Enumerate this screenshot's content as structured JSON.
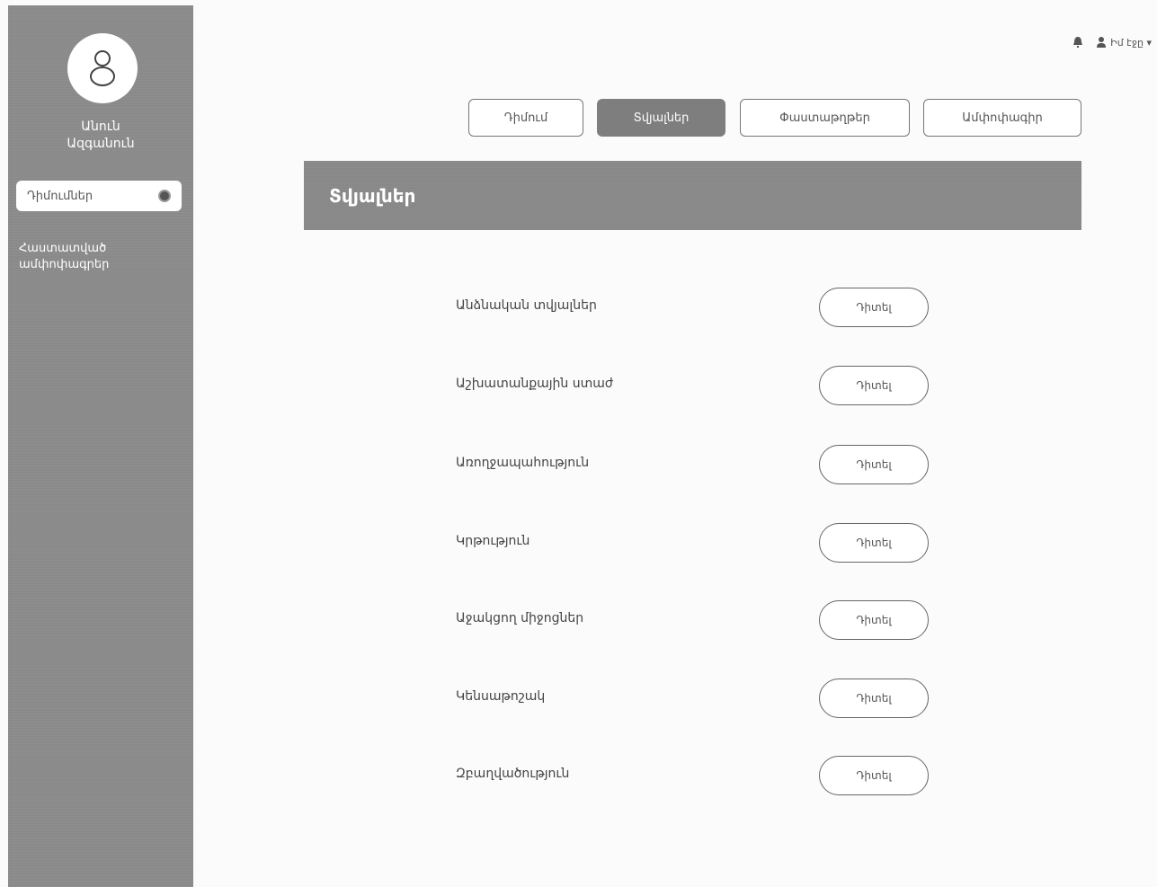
{
  "sidebar": {
    "user_first_name": "Անուն",
    "user_last_name": "Ազգանուն",
    "active_item_label": "Դիմումներ",
    "items": [
      {
        "label": "Հաստատված ամփոփագրեր"
      }
    ]
  },
  "topbar": {
    "user_label": "Իմ էջը ▾"
  },
  "tabs": [
    {
      "label": "Դիմում",
      "active": false
    },
    {
      "label": "Տվյալներ",
      "active": true
    },
    {
      "label": "Փաստաթղթեր",
      "active": false
    },
    {
      "label": "Ամփոփագիր",
      "active": false
    }
  ],
  "section": {
    "title": "Տվյալներ"
  },
  "rows": [
    {
      "label": "Անձնական տվյալներ",
      "button": "Դիտել"
    },
    {
      "label": "Աշխատանքային ստաժ",
      "button": "Դիտել"
    },
    {
      "label": "Առողջապահություն",
      "button": "Դիտել"
    },
    {
      "label": "Կրթություն",
      "button": "Դիտել"
    },
    {
      "label": "Աջակցող միջոցներ",
      "button": "Դիտել"
    },
    {
      "label": "Կենսաթոշակ",
      "button": "Դիտել"
    },
    {
      "label": "Զբաղվածություն",
      "button": "Դիտել"
    }
  ],
  "colors": {
    "sidebar": "#8a8a8a",
    "header": "#888888",
    "active_tab": "#7e7e7e"
  }
}
